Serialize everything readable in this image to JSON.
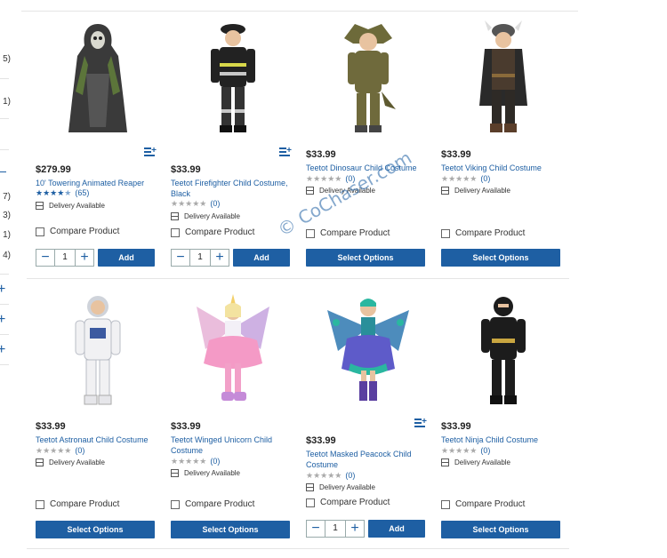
{
  "sidebar": {
    "counts": [
      "5)",
      "1)",
      "7)",
      "3)",
      "1)",
      "4)"
    ]
  },
  "ui": {
    "compare_label": "Compare Product",
    "delivery_label": "Delivery Available",
    "add_label": "Add",
    "select_label": "Select Options",
    "qty_minus": "−",
    "qty_plus": "+"
  },
  "products": [
    {
      "price": "$279.99",
      "name": "10' Towering Animated Reaper",
      "rating_stars": 4.5,
      "review_count": "(65)",
      "qty": "1",
      "action": "add",
      "image": "reaper-costume"
    },
    {
      "price": "$33.99",
      "name": "Teetot Firefighter Child Costume, Black",
      "rating_stars": 0,
      "review_count": "(0)",
      "qty": "1",
      "action": "add",
      "image": "firefighter-costume"
    },
    {
      "price": "$33.99",
      "name": "Teetot Dinosaur Child Costume",
      "rating_stars": 0,
      "review_count": "(0)",
      "action": "select",
      "image": "dinosaur-costume"
    },
    {
      "price": "$33.99",
      "name": "Teetot Viking Child Costume",
      "rating_stars": 0,
      "review_count": "(0)",
      "action": "select",
      "image": "viking-costume"
    },
    {
      "price": "$33.99",
      "name": "Teetot Astronaut Child Costume",
      "rating_stars": 0,
      "review_count": "(0)",
      "action": "select",
      "image": "astronaut-costume"
    },
    {
      "price": "$33.99",
      "name": "Teetot Winged Unicorn Child Costume",
      "rating_stars": 0,
      "review_count": "(0)",
      "action": "select",
      "image": "unicorn-costume"
    },
    {
      "price": "$33.99",
      "name": "Teetot Masked Peacock Child Costume",
      "rating_stars": 0,
      "review_count": "(0)",
      "qty": "1",
      "action": "add",
      "image": "peacock-costume"
    },
    {
      "price": "$33.99",
      "name": "Teetot Ninja Child Costume",
      "rating_stars": 0,
      "review_count": "(0)",
      "action": "select",
      "image": "ninja-costume"
    }
  ],
  "watermark": "© CoChaser.com",
  "colors": {
    "brand_blue": "#1e5fa3",
    "divider": "#e5e5e5"
  },
  "icons": [
    "add-to-list-icon",
    "delivery-box-icon",
    "checkbox-icon",
    "star-icon",
    "plus-icon",
    "minus-icon"
  ]
}
